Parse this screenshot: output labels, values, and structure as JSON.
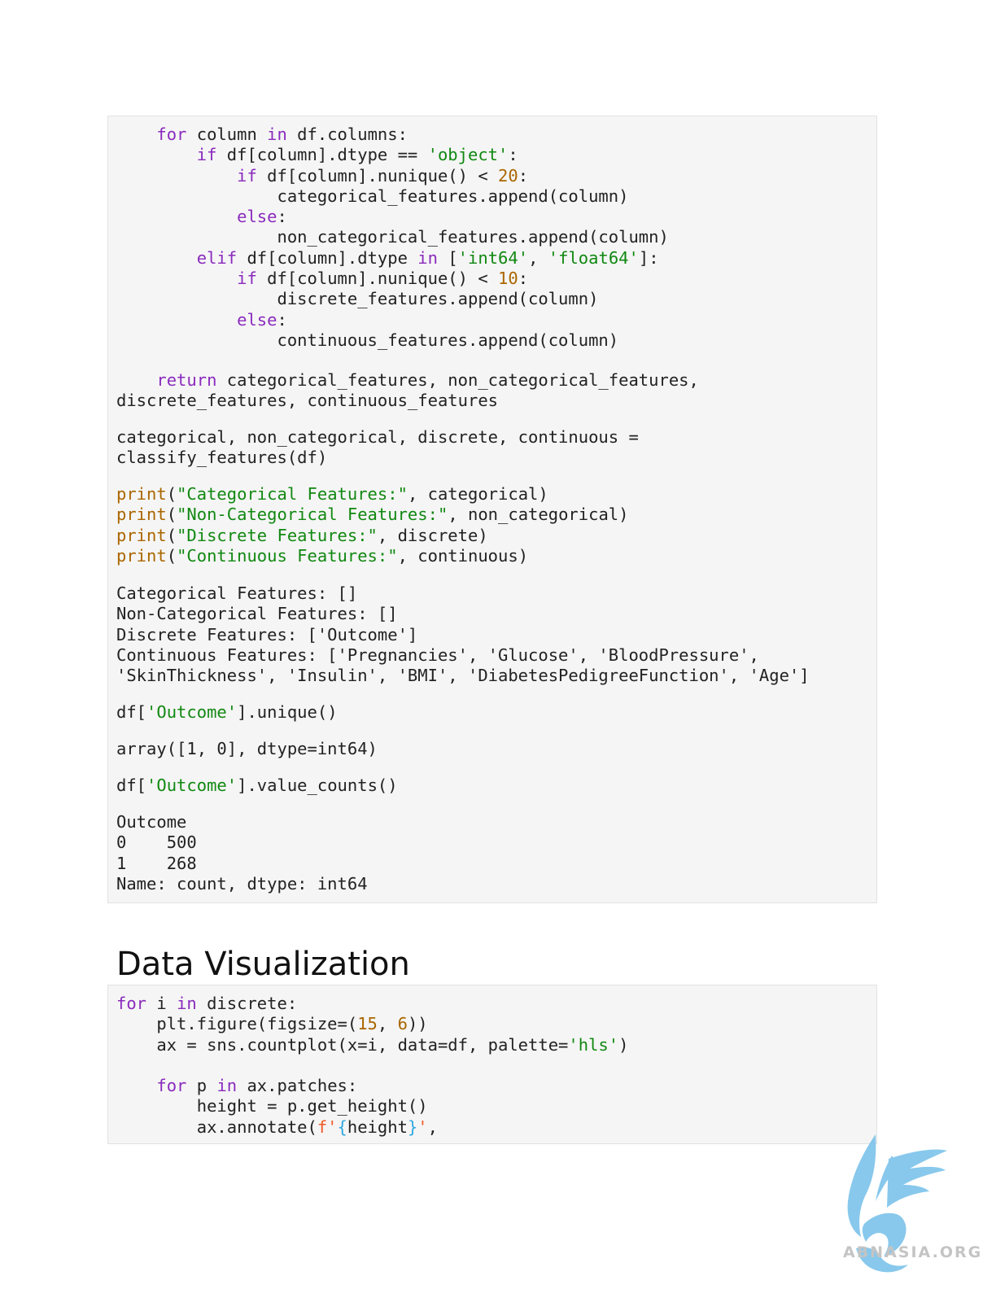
{
  "cell1": {
    "loop_block": [
      [
        {
          "t": "    "
        },
        {
          "t": "for",
          "c": "kw"
        },
        {
          "t": " column "
        },
        {
          "t": "in",
          "c": "kw"
        },
        {
          "t": " df.columns:"
        }
      ],
      [
        {
          "t": "        "
        },
        {
          "t": "if",
          "c": "kw"
        },
        {
          "t": " df[column].dtype == "
        },
        {
          "t": "'object'",
          "c": "str"
        },
        {
          "t": ":"
        }
      ],
      [
        {
          "t": "            "
        },
        {
          "t": "if",
          "c": "kw"
        },
        {
          "t": " df[column].nunique() < "
        },
        {
          "t": "20",
          "c": "num"
        },
        {
          "t": ":"
        }
      ],
      [
        {
          "t": "                categorical_features.append(column)"
        }
      ],
      [
        {
          "t": "            "
        },
        {
          "t": "else",
          "c": "kw"
        },
        {
          "t": ":"
        }
      ],
      [
        {
          "t": "                non_categorical_features.append(column)"
        }
      ],
      [
        {
          "t": "        "
        },
        {
          "t": "elif",
          "c": "kw"
        },
        {
          "t": " df[column].dtype "
        },
        {
          "t": "in",
          "c": "kw"
        },
        {
          "t": " ["
        },
        {
          "t": "'int64'",
          "c": "str"
        },
        {
          "t": ", "
        },
        {
          "t": "'float64'",
          "c": "str"
        },
        {
          "t": "]:"
        }
      ],
      [
        {
          "t": "            "
        },
        {
          "t": "if",
          "c": "kw"
        },
        {
          "t": " df[column].nunique() < "
        },
        {
          "t": "10",
          "c": "num"
        },
        {
          "t": ":"
        }
      ],
      [
        {
          "t": "                discrete_features.append(column)"
        }
      ],
      [
        {
          "t": "            "
        },
        {
          "t": "else",
          "c": "kw"
        },
        {
          "t": ":"
        }
      ],
      [
        {
          "t": "                continuous_features.append(column)"
        }
      ]
    ],
    "return_block": [
      [
        {
          "t": "    "
        },
        {
          "t": "return",
          "c": "kw"
        },
        {
          "t": " categorical_features, non_categorical_features,"
        }
      ],
      [
        {
          "t": "discrete_features, continuous_features"
        }
      ]
    ],
    "assign_block": [
      [
        {
          "t": "categorical, non_categorical, discrete, continuous ="
        }
      ],
      [
        {
          "t": "classify_features(df)"
        }
      ]
    ],
    "print_block": [
      [
        {
          "t": "print",
          "c": "num"
        },
        {
          "t": "("
        },
        {
          "t": "\"Categorical Features:\"",
          "c": "str"
        },
        {
          "t": ", categorical)"
        }
      ],
      [
        {
          "t": "print",
          "c": "num"
        },
        {
          "t": "("
        },
        {
          "t": "\"Non-Categorical Features:\"",
          "c": "str"
        },
        {
          "t": ", non_categorical)"
        }
      ],
      [
        {
          "t": "print",
          "c": "num"
        },
        {
          "t": "("
        },
        {
          "t": "\"Discrete Features:\"",
          "c": "str"
        },
        {
          "t": ", discrete)"
        }
      ],
      [
        {
          "t": "print",
          "c": "num"
        },
        {
          "t": "("
        },
        {
          "t": "\"Continuous Features:\"",
          "c": "str"
        },
        {
          "t": ", continuous)"
        }
      ]
    ],
    "features_output": [
      [
        {
          "t": "Categorical Features: []"
        }
      ],
      [
        {
          "t": "Non-Categorical Features: []"
        }
      ],
      [
        {
          "t": "Discrete Features: ['Outcome']"
        }
      ],
      [
        {
          "t": "Continuous Features: ['Pregnancies', 'Glucose', 'BloodPressure',"
        }
      ],
      [
        {
          "t": "'SkinThickness', 'Insulin', 'BMI', 'DiabetesPedigreeFunction', 'Age']"
        }
      ]
    ],
    "unique_call": [
      [
        {
          "t": "df["
        },
        {
          "t": "'Outcome'",
          "c": "str"
        },
        {
          "t": "].unique()"
        }
      ]
    ],
    "unique_output": [
      [
        {
          "t": "array([1, 0], dtype=int64)"
        }
      ]
    ],
    "value_counts_call": [
      [
        {
          "t": "df["
        },
        {
          "t": "'Outcome'",
          "c": "str"
        },
        {
          "t": "].value_counts()"
        }
      ]
    ],
    "value_counts_output": [
      [
        {
          "t": "Outcome"
        }
      ],
      [
        {
          "t": "0    500"
        }
      ],
      [
        {
          "t": "1    268"
        }
      ],
      [
        {
          "t": "Name: count, dtype: int64"
        }
      ]
    ]
  },
  "section_heading": "Data Visualization",
  "cell2": {
    "code": [
      [
        {
          "t": "for",
          "c": "kw"
        },
        {
          "t": " i "
        },
        {
          "t": "in",
          "c": "kw"
        },
        {
          "t": " discrete:"
        }
      ],
      [
        {
          "t": "    plt.figure(figsize=("
        },
        {
          "t": "15",
          "c": "num"
        },
        {
          "t": ", "
        },
        {
          "t": "6",
          "c": "num"
        },
        {
          "t": "))"
        }
      ],
      [
        {
          "t": "    ax = sns.countplot(x=i, data=df, palette="
        },
        {
          "t": "'hls'",
          "c": "str"
        },
        {
          "t": ")"
        }
      ],
      [
        {
          "t": ""
        }
      ],
      [
        {
          "t": "    "
        },
        {
          "t": "for",
          "c": "kw"
        },
        {
          "t": " p "
        },
        {
          "t": "in",
          "c": "kw"
        },
        {
          "t": " ax.patches:"
        }
      ],
      [
        {
          "t": "        height = p.get_height()"
        }
      ],
      [
        {
          "t": "        ax.annotate("
        },
        {
          "t": "f'",
          "c": "fstr"
        },
        {
          "t": "{",
          "c": "brace"
        },
        {
          "t": "height"
        },
        {
          "t": "}",
          "c": "brace"
        },
        {
          "t": "'",
          "c": "fstr"
        },
        {
          "t": ","
        }
      ]
    ]
  },
  "watermark": {
    "text": "ABNASIA.ORG",
    "icon": "griffin-logo-icon",
    "color": "#7cc3ea"
  }
}
